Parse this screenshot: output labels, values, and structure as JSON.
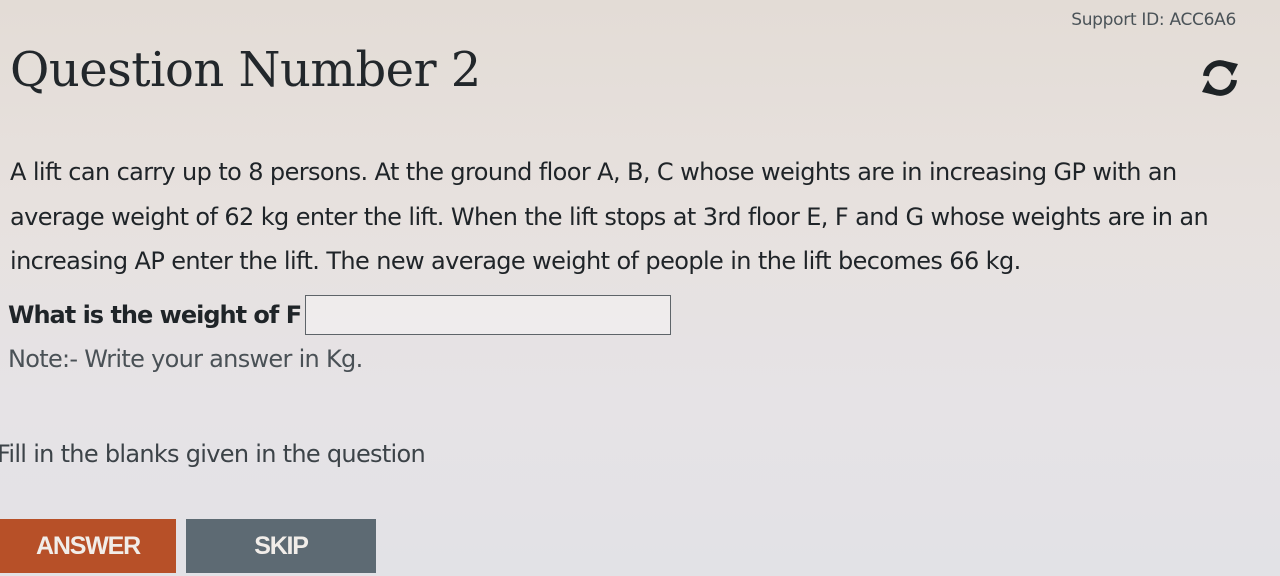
{
  "header": {
    "support_id": "Support ID: ACC6A6",
    "title": "Question Number 2",
    "refresh_icon": "refresh-icon"
  },
  "question": {
    "text": "A lift can carry up to 8 persons. At the ground floor A, B, C whose weights are in increasing GP with an average weight of 62 kg enter the lift. When the lift stops at 3rd floor E, F and G whose weights are in an increasing AP enter the lift. The new average weight of people in the lift becomes 66 kg.",
    "ask_label": "What is the weight of F",
    "answer_value": "",
    "note": "Note:- Write your answer in Kg."
  },
  "instruction": "Fill in the blanks given in the question",
  "actions": {
    "answer_label": "ANSWER",
    "skip_label": "SKIP"
  },
  "colors": {
    "answer_button": "#b75028",
    "skip_button": "#5d6a73",
    "refresh_icon": "#1e2326"
  }
}
